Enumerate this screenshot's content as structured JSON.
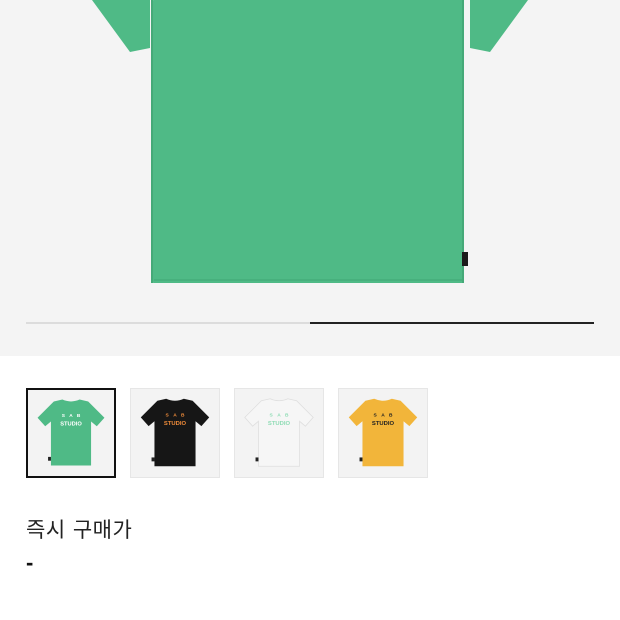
{
  "product": {
    "main_color": "#4fba86",
    "logo_text": [
      "S",
      "A",
      "B"
    ],
    "logo_subtext": "STUDIO"
  },
  "gallery": {
    "current_slide_fraction_start": 0.5,
    "current_slide_fraction_end": 1.0
  },
  "thumbnails": [
    {
      "color": "#4fba86",
      "logo_color": "#ffffff",
      "selected": true
    },
    {
      "color": "#161616",
      "logo_color": "#f08c3a",
      "selected": false
    },
    {
      "color": "#f6f6f6",
      "logo_color": "#8fdcb5",
      "selected": false
    },
    {
      "color": "#f2b53a",
      "logo_color": "#222222",
      "selected": false
    }
  ],
  "price": {
    "label": "즉시 구매가",
    "value": "-"
  }
}
